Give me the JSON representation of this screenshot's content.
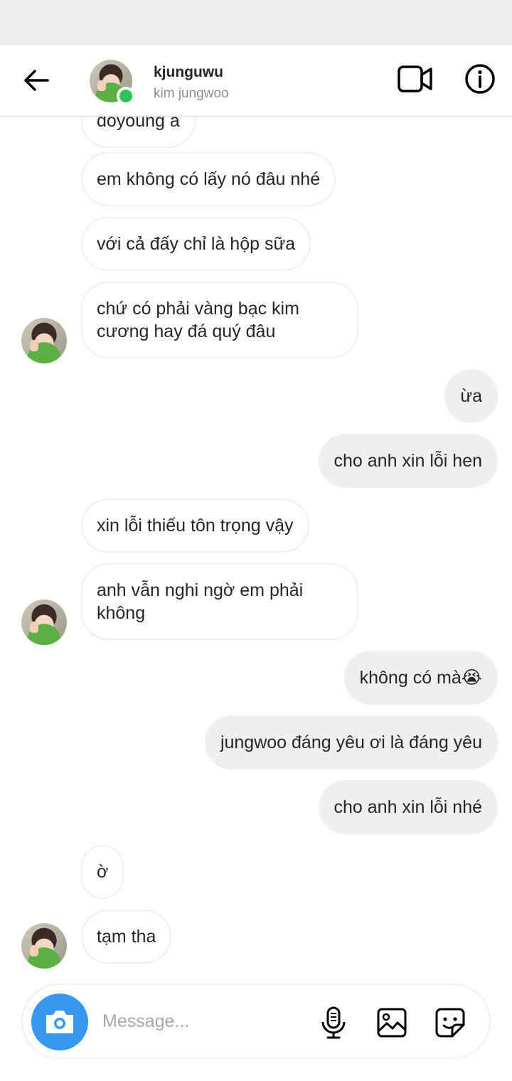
{
  "header": {
    "username": "kjunguwu",
    "fullname": "kim jungwoo",
    "online": true
  },
  "messages": [
    {
      "side": "in",
      "text": "doyoung a"
    },
    {
      "side": "in",
      "text": "em không có  lấy nó đâu nhé"
    },
    {
      "side": "in",
      "text": "với cả đấy chỉ là  hộp  sữa"
    },
    {
      "side": "in",
      "text": "chứ  có  phải vàng bạc  kim cương hay đá quý đâu"
    },
    {
      "side": "out",
      "text": "ừa"
    },
    {
      "side": "out",
      "text": "cho anh xin lỗi hen"
    },
    {
      "side": "in",
      "text": "xin lỗi thiếu tôn trọng vậy"
    },
    {
      "side": "in",
      "text": "anh vẫn nghi ngờ em phải không"
    },
    {
      "side": "out",
      "text": "không có mà😭"
    },
    {
      "side": "out",
      "text": "jungwoo đáng yêu ơi  là đáng yêu"
    },
    {
      "side": "out",
      "text": "cho anh xin lỗi nhé"
    },
    {
      "side": "in",
      "text": "ờ"
    },
    {
      "side": "in",
      "text": "tạm tha"
    }
  ],
  "composer": {
    "placeholder": "Message...",
    "value": ""
  },
  "colors": {
    "outgoing_bubble": "#efefef",
    "incoming_border": "#efefef",
    "camera_button": "#3897f0",
    "online_dot": "#2ec45a"
  },
  "icons": [
    "back-arrow-icon",
    "video-call-icon",
    "info-icon",
    "camera-icon",
    "microphone-icon",
    "gallery-icon",
    "sticker-icon"
  ]
}
